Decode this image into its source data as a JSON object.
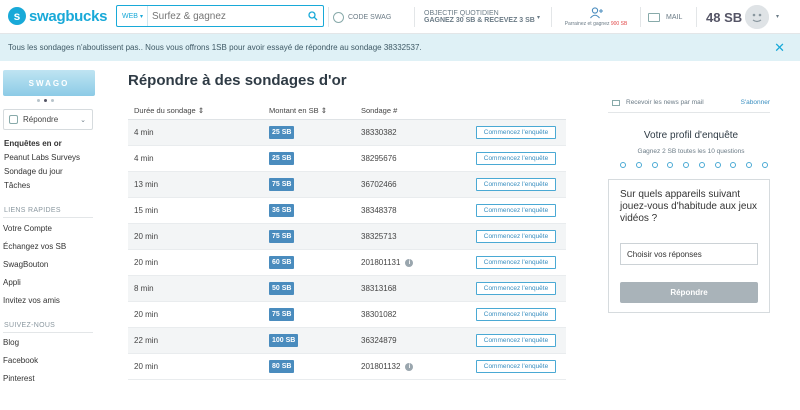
{
  "header": {
    "logo_text": "swagbucks",
    "search_scope": "WEB",
    "search_placeholder": "Surfez & gagnez",
    "code_swag": "CODE SWAG",
    "objectif_line1": "OBJECTIF QUOTIDIEN",
    "objectif_line2": "GAGNEZ 30 SB & RECEVEZ 3 SB",
    "invite_text": "Parrainez et gagnez",
    "invite_amount": "900 SB",
    "mail_label": "MAIL",
    "balance": "48 SB"
  },
  "notice": {
    "text": "Tous les sondages n'aboutissent pas.. Nous vous offrons 1SB pour avoir essayé de répondre au sondage 38332537."
  },
  "sidebar": {
    "banner_text": "SWAGO",
    "dropdown_label": "Répondre",
    "nav": [
      {
        "label": "Enquêtes en or",
        "active": true
      },
      {
        "label": "Peanut Labs Surveys"
      },
      {
        "label": "Sondage du jour"
      },
      {
        "label": "Tâches"
      }
    ],
    "quick_links_title": "LIENS RAPIDES",
    "quick_links": [
      "Votre Compte",
      "Échangez vos SB",
      "SwagBouton",
      "Appli",
      "Invitez vos amis"
    ],
    "follow_title": "SUIVEZ-NOUS",
    "follow_links": [
      "Blog",
      "Facebook",
      "Pinterest"
    ]
  },
  "main": {
    "title": "Répondre à des sondages d'or",
    "columns": [
      "Durée du sondage",
      "Montant en SB",
      "Sondage #"
    ],
    "button_label": "Commencez l'enquête",
    "rows": [
      {
        "duration": "4 min",
        "amount": "25 SB",
        "survey": "38330382",
        "info": false
      },
      {
        "duration": "4 min",
        "amount": "25 SB",
        "survey": "38295676",
        "info": false
      },
      {
        "duration": "13 min",
        "amount": "75 SB",
        "survey": "36702466",
        "info": false
      },
      {
        "duration": "15 min",
        "amount": "36 SB",
        "survey": "38348378",
        "info": false
      },
      {
        "duration": "20 min",
        "amount": "75 SB",
        "survey": "38325713",
        "info": false
      },
      {
        "duration": "20 min",
        "amount": "60 SB",
        "survey": "201801131",
        "info": true
      },
      {
        "duration": "8 min",
        "amount": "50 SB",
        "survey": "38313168",
        "info": false
      },
      {
        "duration": "20 min",
        "amount": "75 SB",
        "survey": "38301082",
        "info": false
      },
      {
        "duration": "22 min",
        "amount": "100 SB",
        "survey": "36324879",
        "info": false
      },
      {
        "duration": "20 min",
        "amount": "80 SB",
        "survey": "201801132",
        "info": true
      }
    ]
  },
  "right": {
    "news_label": "Recevoir les news par mail",
    "subscribe_label": "S'abonner",
    "profile_title": "Votre profil d'enquête",
    "profile_sub": "Gagnez 2 SB toutes les 10 questions",
    "question": "Sur quels appareils suivant jouez-vous d'habitude aux jeux vidéos ?",
    "select_label": "Choisir vos réponses",
    "submit_label": "Répondre"
  },
  "colors": {
    "brand": "#18a9d8",
    "amount_badge": "#4a8cbe",
    "notice_bg": "#dff1f6"
  }
}
